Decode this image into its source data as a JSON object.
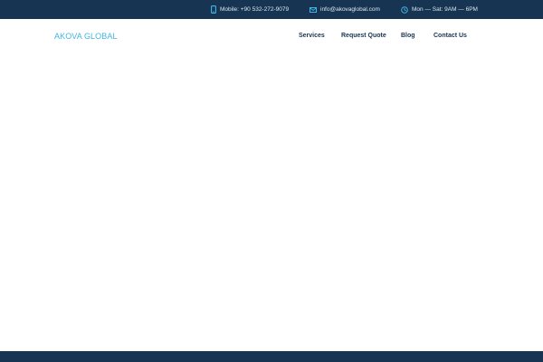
{
  "topbar": {
    "phone": {
      "icon": "mobile-phone-icon",
      "text": "Mobile: +90 532-272-9079"
    },
    "email": {
      "icon": "envelope-icon",
      "text": "info@akovaglobal.com"
    },
    "hours": {
      "icon": "clock-icon",
      "text": "Mon — Sat: 9AM — 6PM"
    }
  },
  "header": {
    "logo": "AKOVA GLOBAL",
    "nav": {
      "services": "Services",
      "request_quote": "Request Quote",
      "blog": "Blog",
      "contact": "Contact Us"
    }
  },
  "colors": {
    "topbar_bg": "#173553",
    "accent": "#3fb6e6",
    "nav_text": "#173553",
    "background": "#ffffff"
  }
}
